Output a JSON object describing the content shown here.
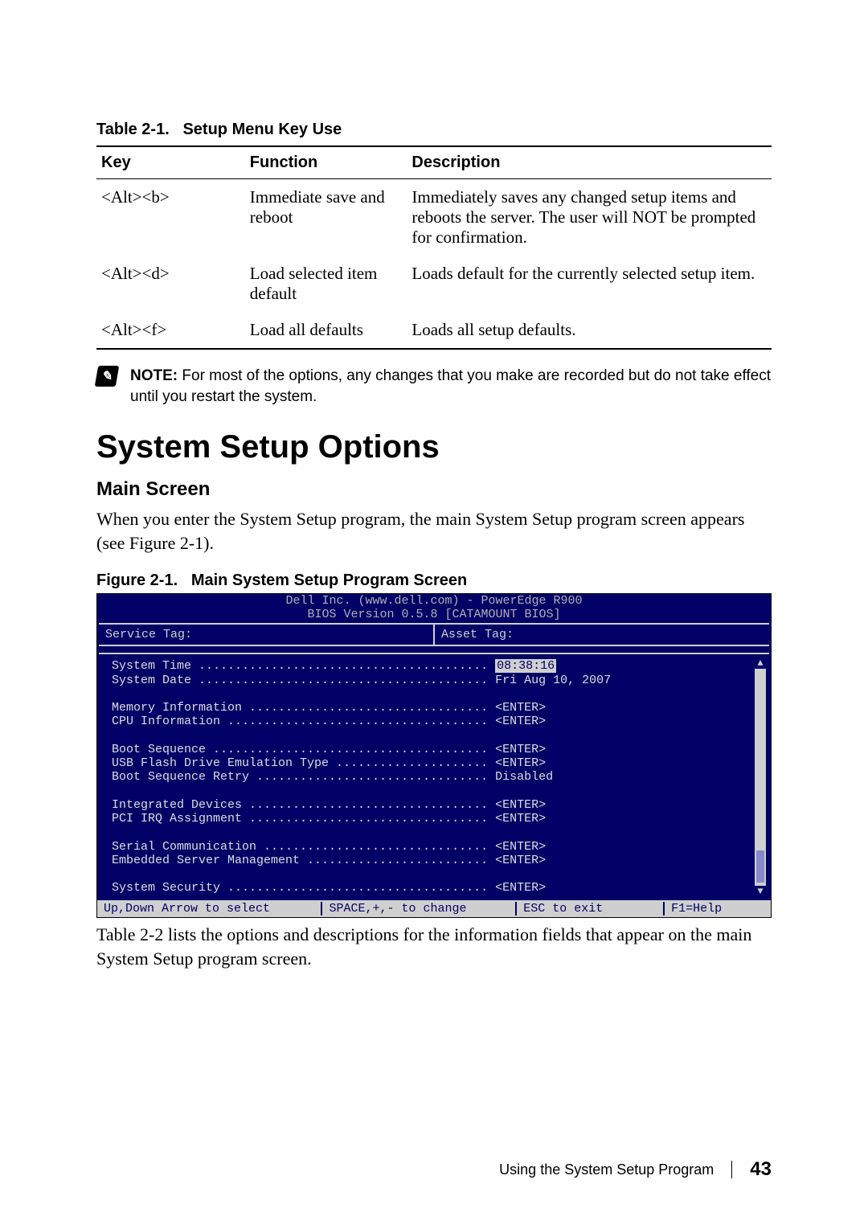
{
  "table": {
    "caption_prefix": "Table 2-1.",
    "caption_text": "Setup Menu Key Use",
    "headers": {
      "key": "Key",
      "function": "Function",
      "description": "Description"
    },
    "rows": [
      {
        "key": "<Alt><b>",
        "func": "Immediate save and reboot",
        "desc": "Immediately saves any changed setup items and reboots the server. The user will NOT be prompted for confirmation."
      },
      {
        "key": "<Alt><d>",
        "func": "Load selected item default",
        "desc": "Loads default for the currently selected setup item."
      },
      {
        "key": "<Alt><f>",
        "func": "Load all defaults",
        "desc": "Loads all setup defaults."
      }
    ]
  },
  "note": {
    "label": "NOTE:",
    "text": "For most of the options, any changes that you make are recorded but do not take effect until you restart the system."
  },
  "section": {
    "title": "System Setup Options",
    "subtitle": "Main Screen",
    "para": "When you enter the System Setup program, the main System Setup program screen appears (see Figure 2-1)."
  },
  "figure": {
    "caption_prefix": "Figure 2-1.",
    "caption_text": "Main System Setup Program Screen"
  },
  "bios": {
    "header_line1": "Dell Inc. (www.dell.com) - PowerEdge R900",
    "header_line2": "BIOS Version 0.5.8 [CATAMOUNT BIOS]",
    "svc_tag_label": "Service Tag:",
    "asset_tag_label": "Asset Tag:",
    "lines": {
      "system_time_label": "System Time ........................................",
      "system_time_value": "08:38:16",
      "system_date": "System Date ........................................ Fri Aug 10, 2007",
      "blank1": "",
      "memory_info": "Memory Information ................................. <ENTER>",
      "cpu_info": "CPU Information .................................... <ENTER>",
      "blank2": "",
      "boot_seq": "Boot Sequence ...................................... <ENTER>",
      "usb_emul": "USB Flash Drive Emulation Type ..................... <ENTER>",
      "boot_retry": "Boot Sequence Retry ................................ Disabled",
      "blank3": "",
      "int_dev": "Integrated Devices ................................. <ENTER>",
      "pci_irq": "PCI IRQ Assignment ................................. <ENTER>",
      "blank4": "",
      "serial_comm": "Serial Communication ............................... <ENTER>",
      "embedded_mgmt": "Embedded Server Management ......................... <ENTER>",
      "blank5": "",
      "system_security": "System Security .................................... <ENTER>"
    },
    "footer": {
      "nav": "Up,Down Arrow to select",
      "change": "SPACE,+,- to change",
      "exit": "ESC to exit",
      "help": "F1=Help"
    }
  },
  "after_para": "Table 2-2 lists the options and descriptions for the information fields that appear on the main System Setup program screen.",
  "page_footer": {
    "label": "Using the System Setup Program",
    "num": "43"
  }
}
